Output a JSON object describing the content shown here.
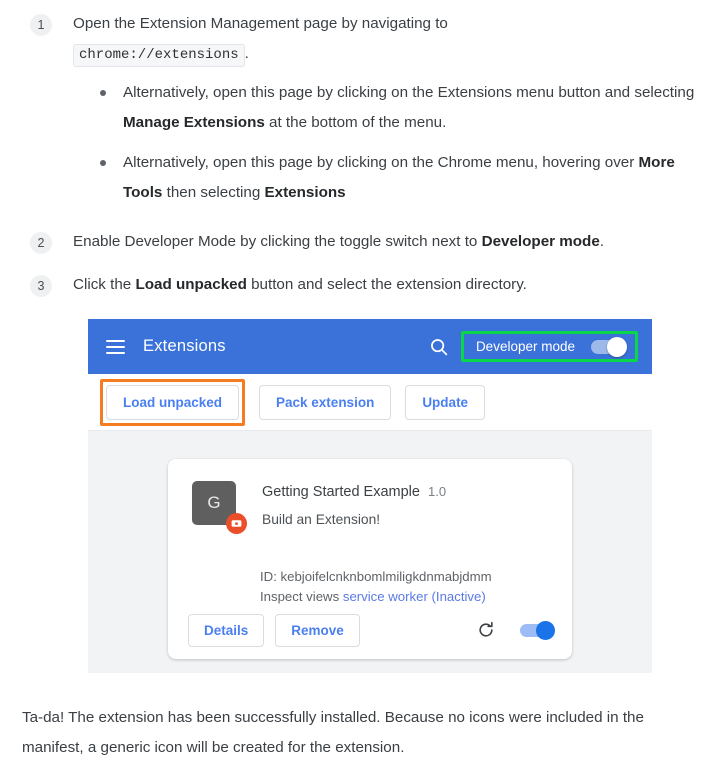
{
  "steps": [
    {
      "number": "1",
      "text_before_code": "Open the Extension Management page by navigating to",
      "code": "chrome://extensions",
      "text_after_code": ".",
      "substeps": [
        {
          "part1": "Alternatively, open this page by clicking on the Extensions menu button and selecting ",
          "bold": "Manage Extensions",
          "part2": " at the bottom of the menu."
        },
        {
          "part1": "Alternatively, open this page by clicking on the Chrome menu, hovering over ",
          "bold": "More Tools",
          "part2": " then selecting ",
          "bold2": "Extensions"
        }
      ]
    },
    {
      "number": "2",
      "part1": "Enable Developer Mode by clicking the toggle switch next to ",
      "bold": "Developer mode",
      "part2": "."
    },
    {
      "number": "3",
      "part1": "Click the ",
      "bold": "Load unpacked",
      "part2": " button and select the extension directory."
    }
  ],
  "screenshot": {
    "header": {
      "title": "Extensions",
      "menu_icon": "hamburger-icon",
      "search_icon": "search-icon",
      "developer_mode_label": "Developer mode",
      "developer_mode_on": true,
      "highlight_color": "#0ad64a",
      "background_color": "#3b72d9"
    },
    "toolbar": {
      "load_unpacked_label": "Load unpacked",
      "pack_extension_label": "Pack extension",
      "update_label": "Update",
      "highlight_color": "#f57c20"
    },
    "extension_card": {
      "icon_letter": "G",
      "badge_icon": "unpacked-extension-badge-icon",
      "name": "Getting Started Example",
      "version": "1.0",
      "description": "Build an Extension!",
      "id_label": "ID: kebjoifelcnknbomlmiligkdnmabjdmm",
      "inspect_views_label": "Inspect views",
      "inspect_views_link": "service worker (Inactive)",
      "details_label": "Details",
      "remove_label": "Remove",
      "reload_icon": "reload-icon",
      "enabled": true,
      "toggle_color": "#1a73e8"
    }
  },
  "outro": "Ta-da! The extension has been successfully installed. Because no icons were included in the manifest, a generic icon will be created for the extension."
}
